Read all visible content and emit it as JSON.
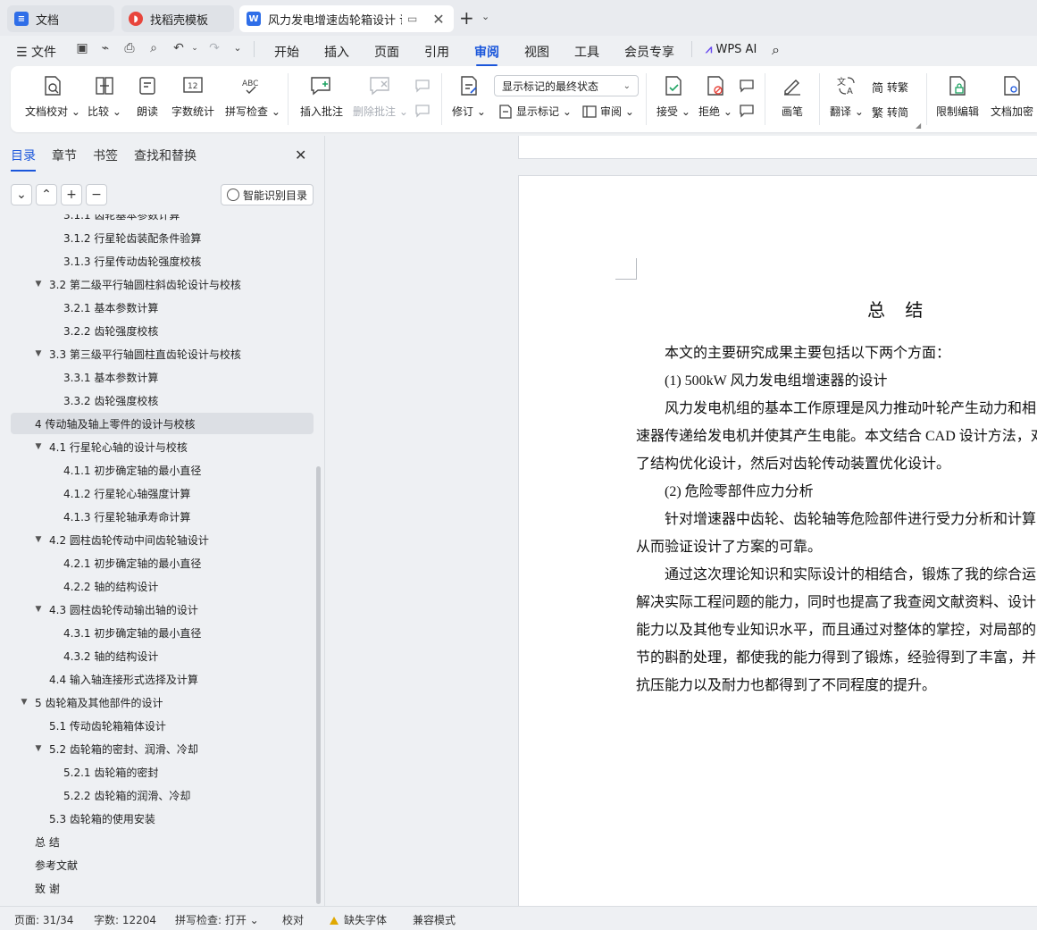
{
  "tabs": [
    {
      "label": "文档",
      "icon": "docs-app-icon",
      "color": "#2f6ee8",
      "glyph": "≡"
    },
    {
      "label": "找稻壳模板",
      "icon": "docer-template-icon",
      "color": "#e8453c",
      "glyph": "◗"
    },
    {
      "label": "风力发电增速齿轮箱设计 说明",
      "icon": "word-doc-icon",
      "color": "#2f6ee8",
      "glyph": "W"
    }
  ],
  "menu": {
    "file": "文件",
    "items": [
      "开始",
      "插入",
      "页面",
      "引用",
      "审阅",
      "视图",
      "工具",
      "会员专享"
    ],
    "active": "审阅",
    "wps_ai": "WPS AI"
  },
  "ribbon": {
    "proofread": "文档校对",
    "compare": "比较",
    "read_aloud": "朗读",
    "word_count": "字数统计",
    "spell_check": "拼写检查",
    "insert_comment": "插入批注",
    "delete_comment": "删除批注",
    "track_changes": "修订",
    "display_select": "显示标记的最终状态",
    "show_markup": "显示标记",
    "review": "审阅",
    "accept": "接受",
    "reject": "拒绝",
    "pen": "画笔",
    "translate": "翻译",
    "to_traditional": "转繁",
    "to_simplified": "转简",
    "restrict_edit": "限制编辑",
    "encrypt": "文档加密"
  },
  "nav": {
    "tabs": [
      "目录",
      "章节",
      "书签",
      "查找和替换"
    ],
    "smart_toc": "智能识别目录",
    "toc": [
      {
        "text": "3.1.1 齿轮基本参数计算",
        "level": 3,
        "caret": false,
        "selected": false
      },
      {
        "text": "3.1.2 行星轮齿装配条件验算",
        "level": 3,
        "caret": false,
        "selected": false
      },
      {
        "text": "3.1.3 行星传动齿轮强度校核",
        "level": 3,
        "caret": false,
        "selected": false
      },
      {
        "text": "3.2 第二级平行轴圆柱斜齿轮设计与校核",
        "level": 2,
        "caret": true,
        "selected": false
      },
      {
        "text": "3.2.1 基本参数计算",
        "level": 3,
        "caret": false,
        "selected": false
      },
      {
        "text": "3.2.2 齿轮强度校核",
        "level": 3,
        "caret": false,
        "selected": false
      },
      {
        "text": "3.3 第三级平行轴圆柱直齿轮设计与校核",
        "level": 2,
        "caret": true,
        "selected": false
      },
      {
        "text": "3.3.1 基本参数计算",
        "level": 3,
        "caret": false,
        "selected": false
      },
      {
        "text": "3.3.2 齿轮强度校核",
        "level": 3,
        "caret": false,
        "selected": false
      },
      {
        "text": "4 传动轴及轴上零件的设计与校核",
        "level": 1,
        "caret": false,
        "selected": true
      },
      {
        "text": "4.1 行星轮心轴的设计与校核",
        "level": 2,
        "caret": true,
        "selected": false
      },
      {
        "text": "4.1.1 初步确定轴的最小直径",
        "level": 3,
        "caret": false,
        "selected": false
      },
      {
        "text": "4.1.2 行星轮心轴强度计算",
        "level": 3,
        "caret": false,
        "selected": false
      },
      {
        "text": "4.1.3 行星轮轴承寿命计算",
        "level": 3,
        "caret": false,
        "selected": false
      },
      {
        "text": "4.2 圆柱齿轮传动中间齿轮轴设计",
        "level": 2,
        "caret": true,
        "selected": false
      },
      {
        "text": "4.2.1 初步确定轴的最小直径",
        "level": 3,
        "caret": false,
        "selected": false
      },
      {
        "text": "4.2.2 轴的结构设计",
        "level": 3,
        "caret": false,
        "selected": false
      },
      {
        "text": "4.3 圆柱齿轮传动输出轴的设计",
        "level": 2,
        "caret": true,
        "selected": false
      },
      {
        "text": "4.3.1 初步确定轴的最小直径",
        "level": 3,
        "caret": false,
        "selected": false
      },
      {
        "text": "4.3.2 轴的结构设计",
        "level": 3,
        "caret": false,
        "selected": false
      },
      {
        "text": "4.4 输入轴连接形式选择及计算",
        "level": 2,
        "caret": false,
        "selected": false
      },
      {
        "text": "5  齿轮箱及其他部件的设计",
        "level": 1,
        "caret": true,
        "selected": false
      },
      {
        "text": "5.1 传动齿轮箱箱体设计",
        "level": 2,
        "caret": false,
        "selected": false
      },
      {
        "text": "5.2 齿轮箱的密封、润滑、冷却",
        "level": 2,
        "caret": true,
        "selected": false
      },
      {
        "text": "5.2.1 齿轮箱的密封",
        "level": 3,
        "caret": false,
        "selected": false
      },
      {
        "text": "5.2.2 齿轮箱的润滑、冷却",
        "level": 3,
        "caret": false,
        "selected": false
      },
      {
        "text": "5.3 齿轮箱的使用安装",
        "level": 2,
        "caret": false,
        "selected": false
      },
      {
        "text": "总 结",
        "level": 1,
        "caret": false,
        "selected": false
      },
      {
        "text": "参考文献",
        "level": 1,
        "caret": false,
        "selected": false
      },
      {
        "text": "致   谢",
        "level": 1,
        "caret": false,
        "selected": false
      }
    ]
  },
  "document": {
    "title": "总 结",
    "paragraphs": [
      "本文的主要研究成果主要包括以下两个方面：",
      "(1) 500kW 风力发电组增速器的设计",
      "风力发电机组的基本工作原理是风力推动叶轮产生动力和相",
      "速器传递给发电机并使其产生电能。本文结合 CAD 设计方法，对",
      "了结构优化设计，然后对齿轮传动装置优化设计。",
      "(2) 危险零部件应力分析",
      "针对增速器中齿轮、齿轮轴等危险部件进行受力分析和计算",
      "从而验证设计了方案的可靠。",
      "通过这次理论知识和实际设计的相结合，锻炼了我的综合运",
      "解决实际工程问题的能力，同时也提高了我查阅文献资料、设计",
      "能力以及其他专业知识水平，而且通过对整体的掌控，对局部的",
      "节的斟酌处理，都使我的能力得到了锻炼，经验得到了丰富，并",
      "抗压能力以及耐力也都得到了不同程度的提升。"
    ]
  },
  "status": {
    "page": "页面: 31/34",
    "words": "字数: 12204",
    "spell": "拼写检查: 打开",
    "proof": "校对",
    "missing_font": "缺失字体",
    "compat": "兼容模式"
  },
  "colors": {
    "accent": "#1a56db",
    "warning": "#e0a800"
  }
}
